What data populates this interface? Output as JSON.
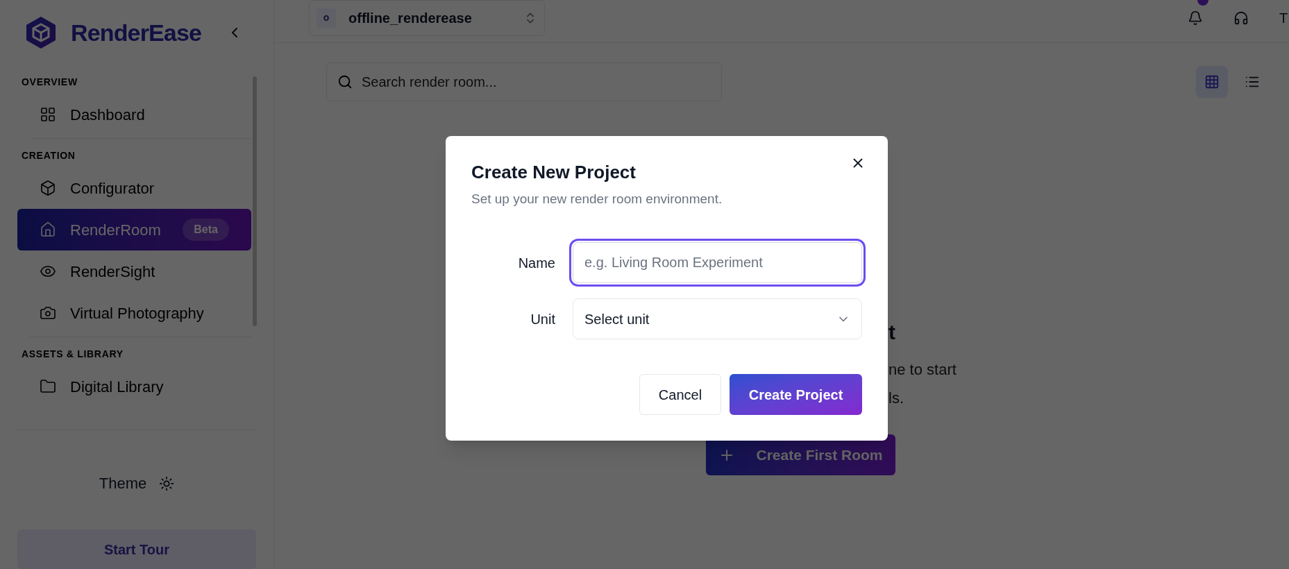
{
  "sidebar": {
    "logo": "RenderEase",
    "sections": [
      {
        "heading": "OVERVIEW",
        "items": [
          {
            "label": "Dashboard",
            "selected": false
          }
        ]
      },
      {
        "heading": "CREATION",
        "items": [
          {
            "label": "Configurator",
            "selected": false
          },
          {
            "label": "RenderRoom",
            "selected": true,
            "badge": "Beta"
          },
          {
            "label": "RenderSight",
            "selected": false
          },
          {
            "label": "Virtual Photography",
            "selected": false
          }
        ]
      },
      {
        "heading": "ASSETS & LIBRARY",
        "items": [
          {
            "label": "Digital Library",
            "selected": false
          }
        ]
      }
    ],
    "theme": "Theme",
    "start_tour": "Start Tour"
  },
  "topbar": {
    "project": {
      "initial": "o",
      "name": "offline_renderease"
    },
    "avatar": "T"
  },
  "search": {
    "placeholder": "Search render room..."
  },
  "view_toggles": [
    {
      "kind": "grid",
      "selected": true
    },
    {
      "kind": "list",
      "selected": false
    }
  ],
  "empty_state": {
    "title": "t",
    "lines": [
      "ne to start",
      "ls."
    ],
    "button": "Create First Room"
  },
  "dialog": {
    "title": "Create New Project",
    "subtitle": "Set up your new render room environment.",
    "fields": [
      {
        "kind": "text",
        "label": "Name",
        "placeholder": "e.g. Living Room Experiment",
        "focused": true
      },
      {
        "kind": "select",
        "label": "Unit",
        "value": "Select unit",
        "focused": false
      }
    ],
    "buttons": [
      {
        "kind": "secondary",
        "label": "Cancel"
      },
      {
        "kind": "primary",
        "label": "Create Project"
      }
    ]
  }
}
